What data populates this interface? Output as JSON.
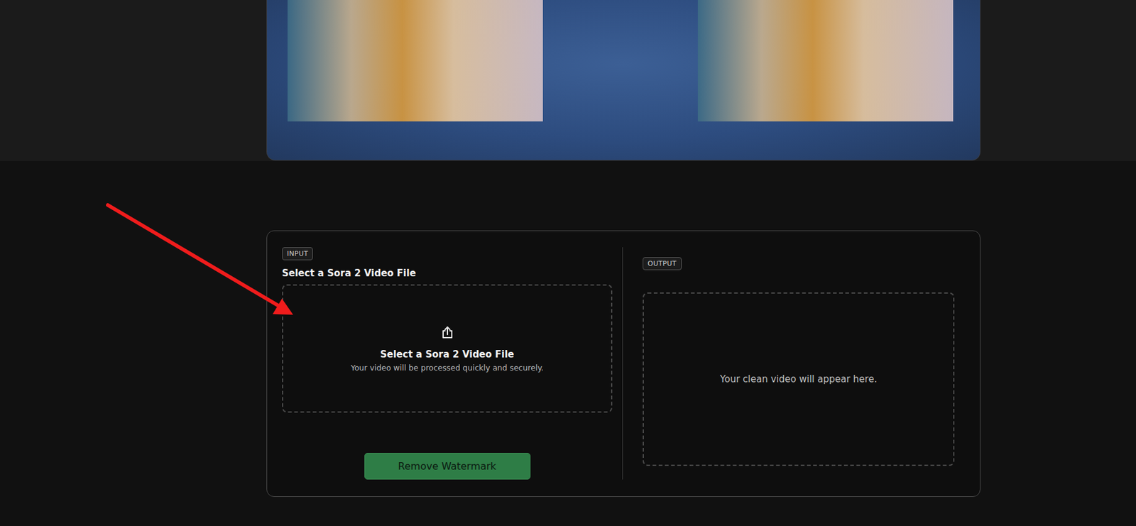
{
  "input": {
    "badge": "INPUT",
    "title": "Select a Sora 2 Video File",
    "dropzone": {
      "title": "Select a Sora 2 Video File",
      "subtitle": "Your video will be processed quickly and securely."
    },
    "button": "Remove Watermark"
  },
  "output": {
    "badge": "OUTPUT",
    "placeholder": "Your clean video will appear here."
  }
}
